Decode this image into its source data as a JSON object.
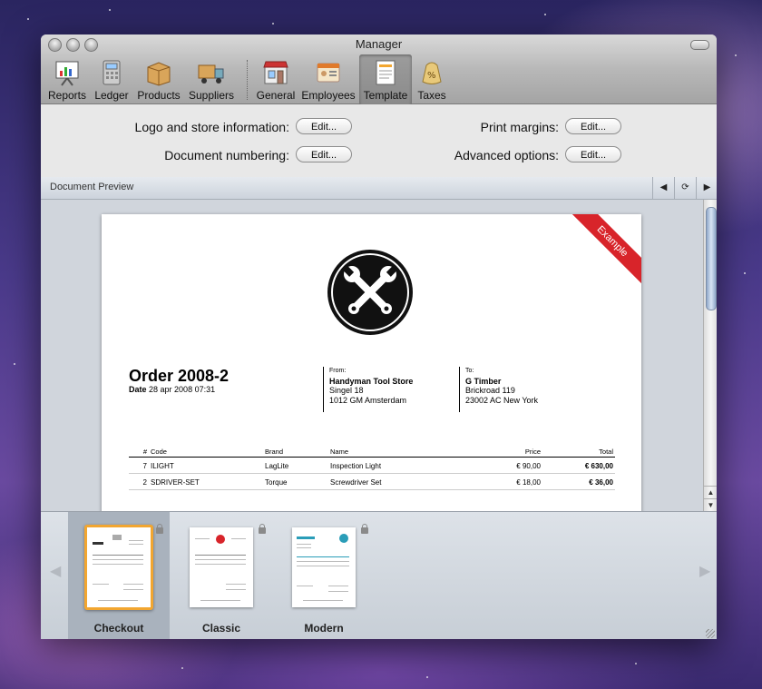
{
  "window": {
    "title": "Manager"
  },
  "toolbar": [
    {
      "id": "reports",
      "label": "Reports",
      "icon": "reports-icon"
    },
    {
      "id": "ledger",
      "label": "Ledger",
      "icon": "ledger-icon"
    },
    {
      "id": "products",
      "label": "Products",
      "icon": "products-icon"
    },
    {
      "id": "suppliers",
      "label": "Suppliers",
      "icon": "suppliers-icon"
    },
    {
      "id": "general",
      "label": "General",
      "icon": "general-icon"
    },
    {
      "id": "employees",
      "label": "Employees",
      "icon": "employees-icon"
    },
    {
      "id": "template",
      "label": "Template",
      "icon": "template-icon",
      "selected": true
    },
    {
      "id": "taxes",
      "label": "Taxes",
      "icon": "taxes-icon"
    }
  ],
  "settings": {
    "logo_label": "Logo and store information:",
    "numbering_label": "Document numbering:",
    "margins_label": "Print margins:",
    "advanced_label": "Advanced options:",
    "edit_label": "Edit..."
  },
  "preview": {
    "title": "Document Preview",
    "prev_icon": "◀",
    "refresh_icon": "⟳",
    "next_icon": "▶"
  },
  "document": {
    "ribbon": "Example",
    "order_title": "Order 2008-2",
    "date_label": "Date",
    "date_value": "28 apr 2008 07:31",
    "from_label": "From:",
    "from_name": "Handyman Tool Store",
    "from_street": "Singel 18",
    "from_city": "1012 GM Amsterdam",
    "to_label": "To:",
    "to_name": "G Timber",
    "to_street": "Brickroad 119",
    "to_city": "23002 AC New York",
    "columns": {
      "num": "#",
      "code": "Code",
      "brand": "Brand",
      "name": "Name",
      "price": "Price",
      "total": "Total"
    },
    "rows": [
      {
        "num": "7",
        "code": "ILIGHT",
        "brand": "LagLite",
        "name": "Inspection Light",
        "price": "€ 90,00",
        "total": "€ 630,00"
      },
      {
        "num": "2",
        "code": "SDRIVER-SET",
        "brand": "Torque",
        "name": "Screwdriver Set",
        "price": "€ 18,00",
        "total": "€ 36,00"
      }
    ]
  },
  "templates": [
    {
      "label": "Checkout",
      "selected": true
    },
    {
      "label": "Classic",
      "selected": false
    },
    {
      "label": "Modern",
      "selected": false
    }
  ],
  "colors": {
    "accent": "#f2a630",
    "ribbon": "#d8242a",
    "modern": "#2a9db8"
  }
}
